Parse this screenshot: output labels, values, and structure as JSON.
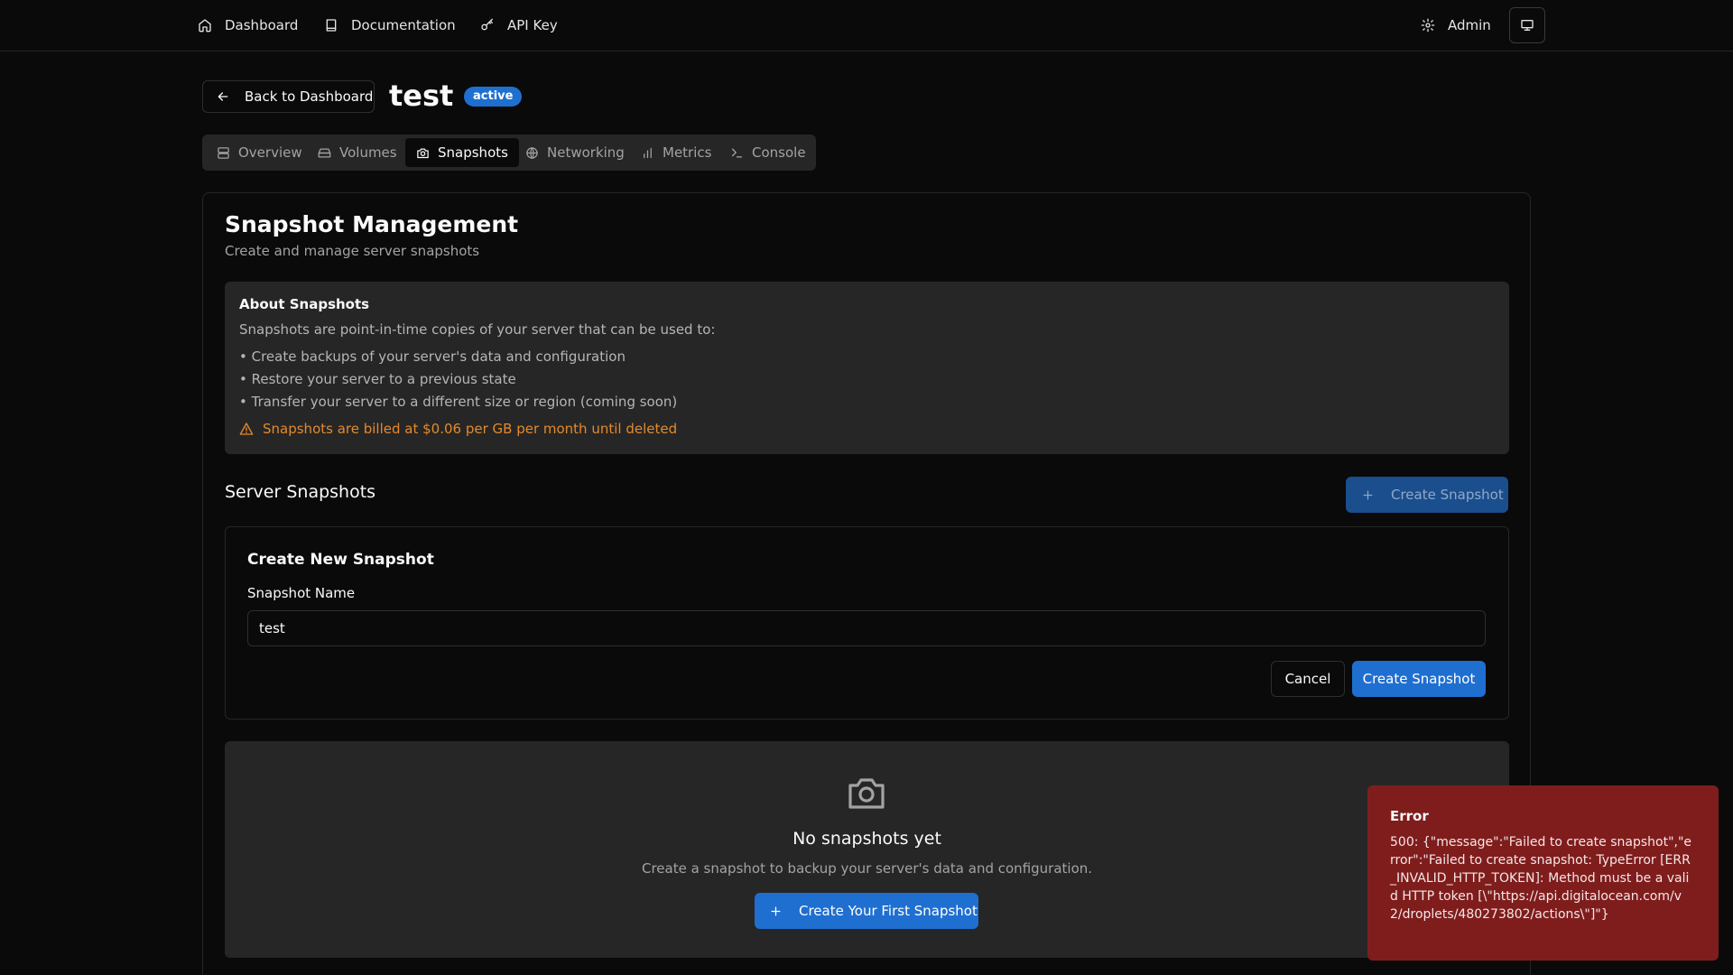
{
  "nav": {
    "dashboard": "Dashboard",
    "documentation": "Documentation",
    "api_key": "API Key",
    "admin": "Admin"
  },
  "header": {
    "back_label": "Back to Dashboard",
    "server_name": "test",
    "status": "active"
  },
  "tabs": [
    {
      "label": "Overview",
      "icon": "server-icon"
    },
    {
      "label": "Volumes",
      "icon": "hard-drive-icon"
    },
    {
      "label": "Snapshots",
      "icon": "camera-icon",
      "active": true
    },
    {
      "label": "Networking",
      "icon": "globe-icon"
    },
    {
      "label": "Metrics",
      "icon": "bar-chart-icon"
    },
    {
      "label": "Console",
      "icon": "terminal-icon"
    }
  ],
  "main": {
    "title": "Snapshot Management",
    "subtitle": "Create and manage server snapshots",
    "about": {
      "title": "About Snapshots",
      "description": "Snapshots are point-in-time copies of your server that can be used to:",
      "bullets": [
        "• Create backups of your server's data and configuration",
        "• Restore your server to a previous state",
        "• Transfer your server to a different size or region (coming soon)"
      ],
      "billing_note": "Snapshots are billed at $0.06 per GB per month until deleted"
    },
    "snapshots_section": {
      "title": "Server Snapshots",
      "create_button": "Create Snapshot"
    },
    "form": {
      "title": "Create New Snapshot",
      "name_label": "Snapshot Name",
      "name_value": "test",
      "cancel_button": "Cancel",
      "submit_button": "Create Snapshot"
    },
    "empty_state": {
      "title": "No snapshots yet",
      "description": "Create a snapshot to backup your server's data and configuration.",
      "button": "Create Your First Snapshot"
    }
  },
  "toast": {
    "title": "Error",
    "message": "500: {\"message\":\"Failed to create snapshot\",\"error\":\"Failed to create snapshot: TypeError [ERR_INVALID_HTTP_TOKEN]: Method must be a valid HTTP token [\\\"https://api.digitalocean.com/v2/droplets/480273802/actions\\\"]\"}"
  },
  "colors": {
    "background": "#0a0a0a",
    "accent": "#1f6fd1",
    "warning": "#e5892b",
    "error_toast": "#7f1d1d"
  }
}
